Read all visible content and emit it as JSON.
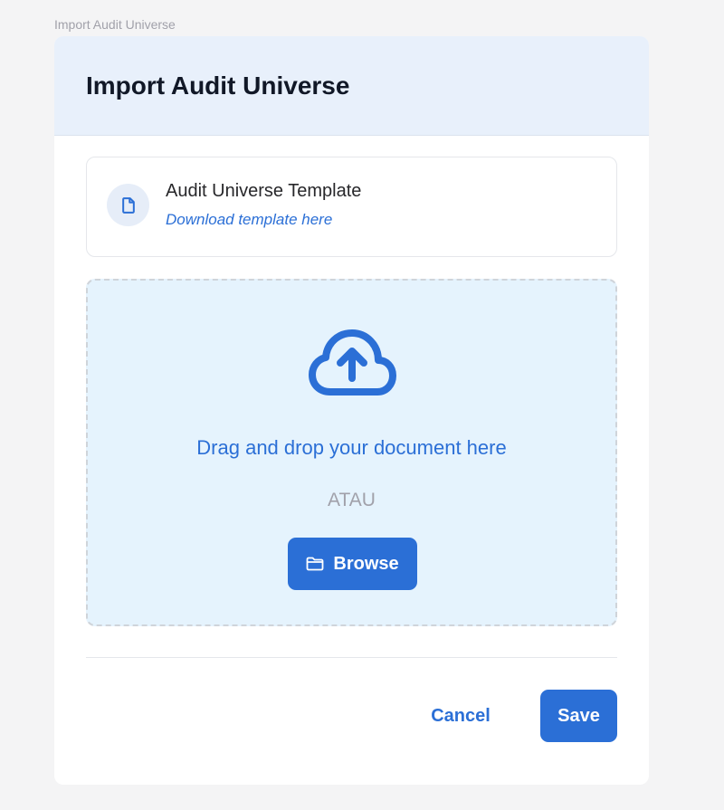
{
  "page": {
    "caption": "Import Audit Universe"
  },
  "modal": {
    "title": "Import Audit Universe",
    "template": {
      "icon": "file-icon",
      "name": "Audit Universe Template",
      "link_label": "Download template here"
    },
    "dropzone": {
      "icon": "cloud-upload-icon",
      "instruction": "Drag and drop your document here",
      "separator": "ATAU",
      "browse_label": "Browse",
      "browse_icon": "folder-icon"
    },
    "footer": {
      "cancel_label": "Cancel",
      "save_label": "Save"
    }
  },
  "colors": {
    "accent": "#2b6fd6",
    "header_bg": "#e8f0fb",
    "dropzone_bg": "#e5f3fd"
  }
}
